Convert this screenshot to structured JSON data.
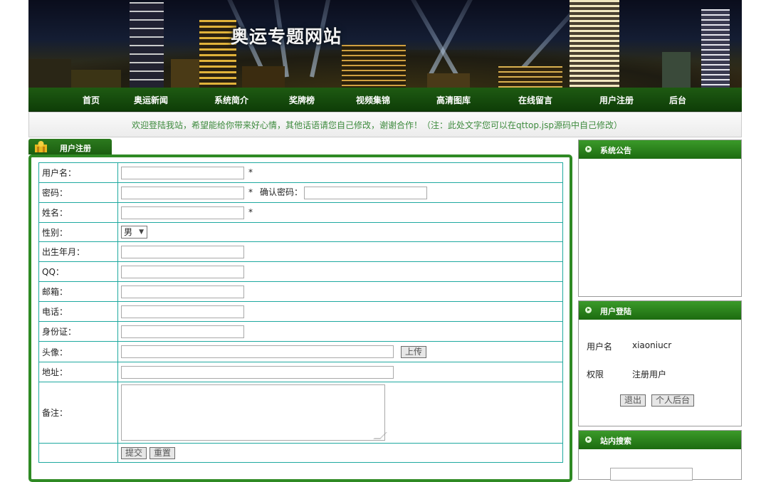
{
  "site": {
    "title": "奥运专题网站"
  },
  "nav": [
    "首页",
    "奥运新闻",
    "系统简介",
    "奖牌榜",
    "视频集锦",
    "高清图库",
    "在线留言",
    "用户注册",
    "后台"
  ],
  "notice": "欢迎登陆我站，希望能给你带来好心情，其他话语请您自己修改，谢谢合作！（注：此处文字您可以在qttop.jsp源码中自己修改）",
  "register": {
    "tab_label": "用户注册",
    "username_label": "用户名：",
    "password_label": "密码：",
    "confirm_label": "确认密码：",
    "name_label": "姓名：",
    "gender_label": "性别：",
    "gender_value": "男",
    "birth_label": "出生年月：",
    "qq_label": "QQ：",
    "email_label": "邮箱：",
    "phone_label": "电话：",
    "idcard_label": "身份证：",
    "avatar_label": "头像：",
    "upload_button": "上传",
    "address_label": "地址：",
    "remark_label": "备注：",
    "submit_button": "提交",
    "reset_button": "重置",
    "required_mark": "*"
  },
  "sidebar": {
    "announcement_title": "系统公告",
    "login_title": "用户登陆",
    "username_key": "用户名",
    "username_value": "xiaoniucr",
    "role_key": "权限",
    "role_value": "注册用户",
    "logout_button": "退出",
    "personal_button": "个人后台",
    "search_title": "站内搜索"
  },
  "colors": {
    "nav": "#1e5a12",
    "accent": "#2f8a24",
    "notice_text": "#3e8b3e",
    "table_border": "#1fa9a0"
  }
}
